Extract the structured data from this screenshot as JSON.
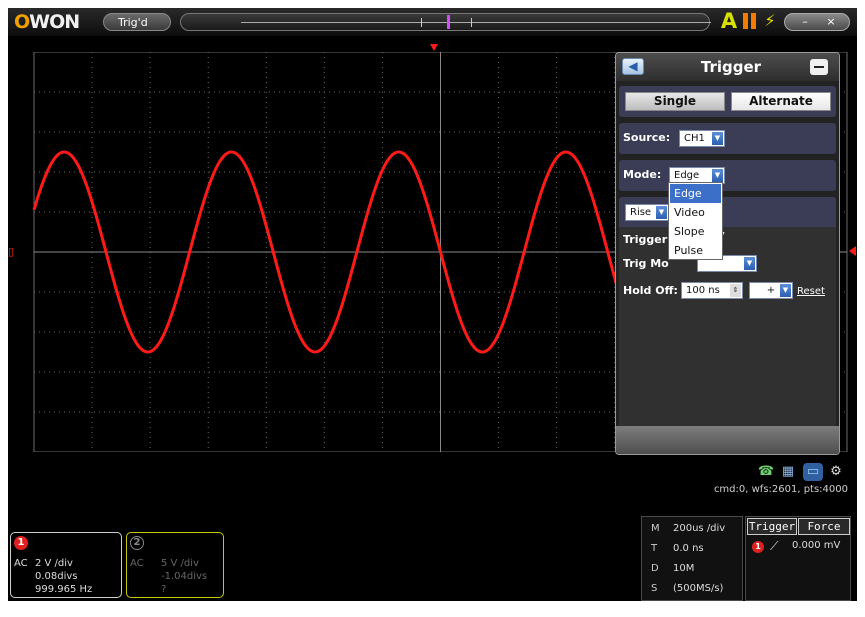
{
  "topbar": {
    "logo_prefix": "O",
    "logo_rest": "WON",
    "status": "Trig'd",
    "icons": {
      "auto": "auto-set-icon",
      "pause": "pause-icon",
      "power": "power-icon"
    },
    "window_controls": {
      "minimize": "–",
      "close": "×"
    }
  },
  "trigger_panel": {
    "title": "Trigger",
    "back_icon": "back-arrow-icon",
    "mode_tabs": {
      "single": "Single",
      "alternate": "Alternate"
    },
    "source_label": "Source:",
    "source_value": "CH1",
    "mode_label": "Mode:",
    "mode_value": "Edge",
    "mode_options": [
      "Edge",
      "Video",
      "Slope",
      "Pulse"
    ],
    "slope_value": "Rise",
    "trigger_label": "Trigger:",
    "trig_mode_label": "Trig Mo",
    "hold_off_label": "Hold Off:",
    "hold_off_value": "100 ns",
    "hold_off_sign": "+",
    "reset": "Reset"
  },
  "status_line": "cmd:0, wfs:2601, pts:4000",
  "channels": {
    "ch1": {
      "number": "1",
      "coupling": "AC",
      "volts_div": "2 V /div",
      "offset": "0.08divs",
      "freq": "999.965 Hz",
      "color": "#e02020"
    },
    "ch2": {
      "number": "2",
      "coupling": "AC",
      "volts_div": "5 V /div",
      "offset": "-1.04divs",
      "freq": "?",
      "color": "#c8c800"
    }
  },
  "timebase": {
    "rows": [
      {
        "key": "M",
        "value": "200us /div"
      },
      {
        "key": "T",
        "value": "0.0 ns"
      },
      {
        "key": "D",
        "value": "10M"
      },
      {
        "key": "S",
        "value": "(500MS/s)"
      }
    ]
  },
  "trigger_info": {
    "trigger_btn": "Trigger",
    "force_btn": "Force",
    "source": "1",
    "level": "0.000 mV"
  },
  "waveform": {
    "color": "#ff1a1a",
    "grid_color": "#6a6a6a"
  }
}
